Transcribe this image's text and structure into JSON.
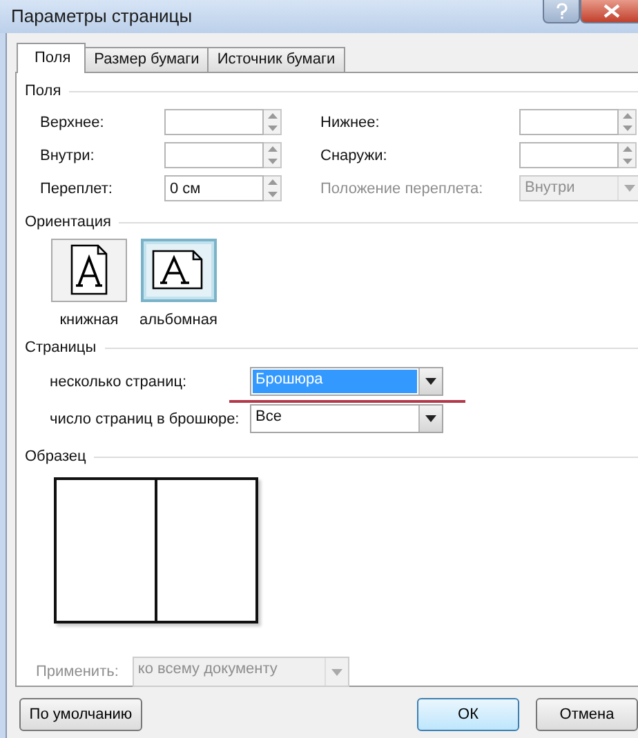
{
  "window": {
    "title": "Параметры страницы"
  },
  "tabs": [
    {
      "label": "Поля",
      "selected": true
    },
    {
      "label": "Размер бумаги",
      "selected": false
    },
    {
      "label": "Источник бумаги",
      "selected": false
    }
  ],
  "margins": {
    "title": "Поля",
    "fields": [
      {
        "label": "Верхнее:",
        "kind": "spin",
        "disabled": false
      },
      {
        "label": "Нижнее:",
        "kind": "spin",
        "disabled": false
      },
      {
        "label": "Внутри:",
        "kind": "spin",
        "disabled": false
      },
      {
        "label": "Снаружи:",
        "kind": "spin",
        "disabled": false
      },
      {
        "label": "Переплет:",
        "kind": "spin",
        "value": "0 см",
        "disabled": false
      },
      {
        "label": "Положение переплета:",
        "kind": "combo",
        "value": "Внутри",
        "disabled": true
      }
    ]
  },
  "orientation": {
    "title": "Ориентация",
    "options": [
      {
        "label": "книжная",
        "kind": "portrait",
        "selected": false
      },
      {
        "label": "альбомная",
        "kind": "landscape",
        "selected": true
      }
    ]
  },
  "pages": {
    "title": "Страницы",
    "fields": [
      {
        "label": "несколько страниц:",
        "value": "Брошюра",
        "highlighted": true,
        "underlined": true
      },
      {
        "label": "число страниц в брошюре:",
        "value": "Все",
        "highlighted": false
      }
    ]
  },
  "preview": {
    "title": "Образец"
  },
  "apply": {
    "label": "Применить:",
    "value": "ко всему документу",
    "disabled": true
  },
  "buttons": [
    {
      "label": "По умолчанию",
      "kind": "default"
    },
    {
      "label": "ОК",
      "kind": "ok"
    },
    {
      "label": "Отмена",
      "kind": "cancel"
    }
  ]
}
